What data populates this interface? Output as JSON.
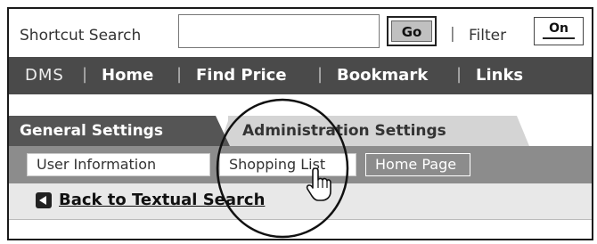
{
  "search": {
    "label": "Shortcut Search",
    "value": "",
    "placeholder": "",
    "go_label": "Go",
    "separator": "|",
    "filter_label": "Filter",
    "filter_toggle": "On"
  },
  "nav": {
    "brand": "DMS",
    "items": [
      "Home",
      "Find Price",
      "Bookmark",
      "Links"
    ],
    "separator": "|"
  },
  "tabs": [
    {
      "label": "General Settings",
      "active": true
    },
    {
      "label": "Administration Settings",
      "active": false
    }
  ],
  "subtabs": [
    {
      "label": "User Information"
    },
    {
      "label": "Shopping List"
    },
    {
      "label": "Home Page"
    }
  ],
  "back_link": {
    "label": "Back to Textual Search",
    "icon": "back-arrow-icon"
  },
  "colors": {
    "navbar": "#4a4a4a",
    "active_tab": "#555555",
    "inactive_tab": "#d4d4d4",
    "subbar": "#8c8c8c",
    "back_row": "#e8e8e8"
  },
  "cursor": {
    "icon": "hand-pointer-icon"
  }
}
